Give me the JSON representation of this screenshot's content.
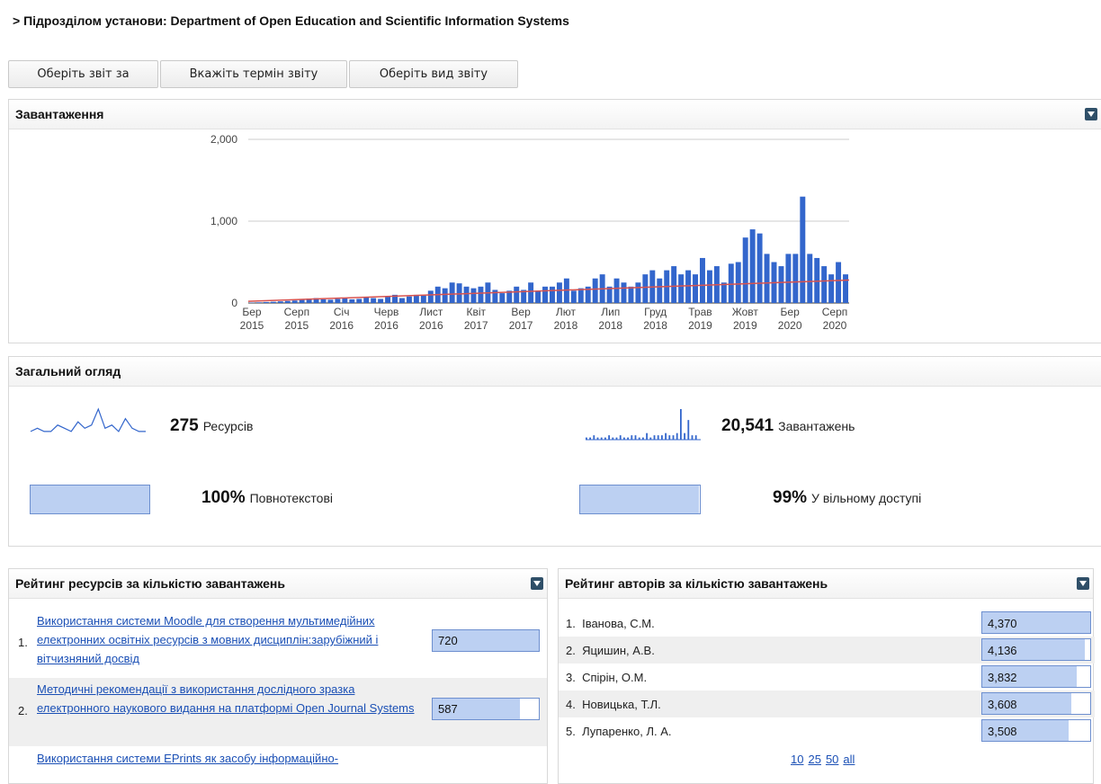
{
  "breadcrumb": "> Підрозділом установи: Department of Open Education and Scientific Information Systems",
  "toolbar": {
    "report_for": "Оберіть звіт за",
    "report_term": "Вкажіть термін звіту",
    "report_type": "Оберіть вид звіту"
  },
  "downloads_panel": {
    "title": "Завантаження"
  },
  "chart_data": {
    "type": "bar",
    "title": "",
    "xlabel": "",
    "ylabel": "",
    "ylim": [
      0,
      2000
    ],
    "yticks": [
      "0",
      "1,000",
      "2,000"
    ],
    "xtick_labels": [
      [
        "Бер",
        "2015"
      ],
      [
        "Серп",
        "2015"
      ],
      [
        "Січ",
        "2016"
      ],
      [
        "Черв",
        "2016"
      ],
      [
        "Лист",
        "2016"
      ],
      [
        "Квіт",
        "2017"
      ],
      [
        "Вер",
        "2017"
      ],
      [
        "Лют",
        "2018"
      ],
      [
        "Лип",
        "2018"
      ],
      [
        "Груд",
        "2018"
      ],
      [
        "Трав",
        "2019"
      ],
      [
        "Жовт",
        "2019"
      ],
      [
        "Бер",
        "2020"
      ],
      [
        "Серп",
        "2020"
      ]
    ],
    "bar_color": "#3366cc",
    "trend_color": "#d9534f",
    "values": [
      5,
      8,
      12,
      15,
      20,
      25,
      30,
      40,
      55,
      60,
      45,
      40,
      50,
      60,
      45,
      50,
      70,
      60,
      50,
      80,
      100,
      60,
      80,
      100,
      100,
      150,
      200,
      180,
      250,
      240,
      200,
      180,
      200,
      250,
      160,
      120,
      150,
      200,
      160,
      250,
      150,
      200,
      200,
      250,
      300,
      150,
      180,
      200,
      300,
      350,
      200,
      300,
      250,
      200,
      250,
      350,
      400,
      300,
      400,
      450,
      350,
      400,
      350,
      550,
      400,
      450,
      250,
      480,
      500,
      800,
      900,
      850,
      600,
      500,
      450,
      600,
      600,
      1300,
      600,
      550,
      450,
      350,
      500,
      350
    ],
    "trend": [
      20,
      280
    ]
  },
  "overview_panel": {
    "title": "Загальний огляд",
    "resources": {
      "value": "275",
      "label": "Ресурсів"
    },
    "downloads": {
      "value": "20,541",
      "label": "Завантажень"
    },
    "fulltext": {
      "value": "100%",
      "label": "Повнотекстові",
      "fraction": 1.0
    },
    "open_access": {
      "value": "99%",
      "label": "У вільному доступі",
      "fraction": 0.99
    },
    "resources_sparkline": [
      2,
      3,
      2,
      2,
      4,
      3,
      2,
      5,
      3,
      4,
      9,
      3,
      4,
      2,
      6,
      3,
      2,
      2
    ],
    "downloads_sparkline": [
      1,
      1,
      2,
      1,
      1,
      1,
      2,
      1,
      1,
      2,
      1,
      1,
      2,
      2,
      1,
      1,
      3,
      1,
      2,
      2,
      2,
      3,
      2,
      2,
      3,
      14,
      3,
      9,
      2,
      2
    ]
  },
  "top_resources": {
    "title": "Рейтинг ресурсів за кількістю завантажень",
    "items": [
      {
        "rank": "1.",
        "title": "Використання системи Moodle для створення мультимедійних електронних освітніх ресурсів з мовних дисциплін:зарубіжний і вітчизняний досвід",
        "count": "720",
        "fraction": 1.0
      },
      {
        "rank": "2.",
        "title": "Методичні рекомендації з використання дослідного зразка електронного наукового видання на платформі Open Journal Systems",
        "count": "587",
        "fraction": 0.82
      },
      {
        "rank": "3.",
        "title": "Використання системи EPrints як засобу інформаційно-",
        "count": "",
        "fraction": 0
      }
    ]
  },
  "top_authors": {
    "title": "Рейтинг авторів за кількістю завантажень",
    "items": [
      {
        "rank": "1.",
        "name": "Іванова, С.М.",
        "count": "4,370",
        "fraction": 1.0
      },
      {
        "rank": "2.",
        "name": "Яцишин, А.В.",
        "count": "4,136",
        "fraction": 0.946
      },
      {
        "rank": "3.",
        "name": "Спірін, О.М.",
        "count": "3,832",
        "fraction": 0.877
      },
      {
        "rank": "4.",
        "name": "Новицька, Т.Л.",
        "count": "3,608",
        "fraction": 0.826
      },
      {
        "rank": "5.",
        "name": "Лупаренко, Л. А.",
        "count": "3,508",
        "fraction": 0.803
      }
    ],
    "pager": [
      "10",
      "25",
      "50",
      "all"
    ]
  }
}
